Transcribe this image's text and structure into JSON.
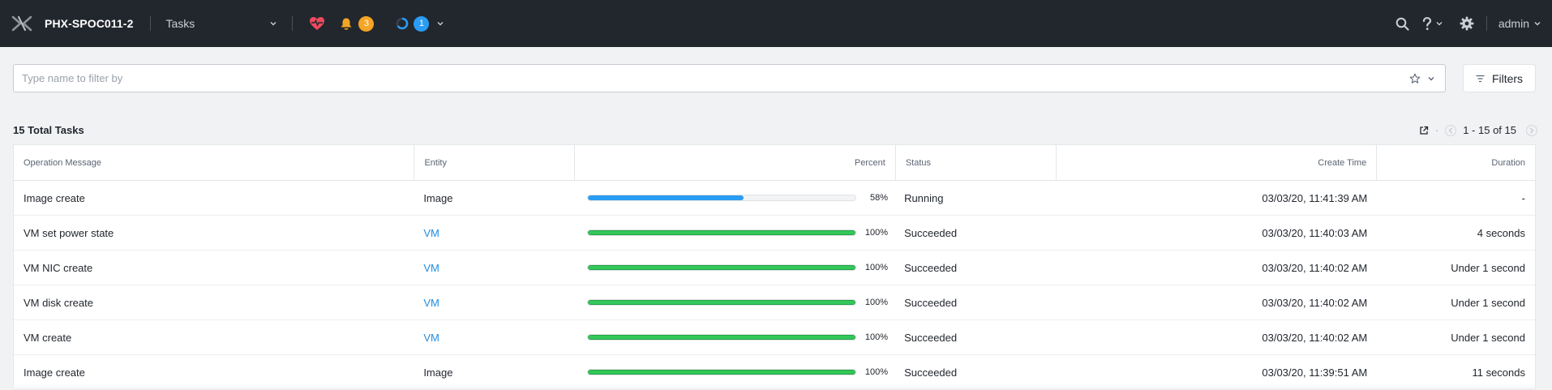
{
  "header": {
    "cluster_name": "PHX-SPOC011-2",
    "nav_selected": "Tasks",
    "alerts_count": "3",
    "tasks_count": "1",
    "user": "admin"
  },
  "filter": {
    "placeholder": "Type name to filter by",
    "filters_label": "Filters"
  },
  "summary": {
    "total_label": "15 Total Tasks",
    "pager_text": "1 - 15 of 15"
  },
  "table": {
    "columns": [
      "Operation Message",
      "Entity",
      "Percent",
      "Status",
      "Create Time",
      "Duration"
    ],
    "rows": [
      {
        "operation": "Image create",
        "entity": "Image",
        "entity_link": false,
        "percent": 58,
        "percent_label": "58%",
        "status": "Running",
        "create_time": "03/03/20, 11:41:39 AM",
        "duration": "-"
      },
      {
        "operation": "VM set power state",
        "entity": "VM",
        "entity_link": true,
        "percent": 100,
        "percent_label": "100%",
        "status": "Succeeded",
        "create_time": "03/03/20, 11:40:03 AM",
        "duration": "4 seconds"
      },
      {
        "operation": "VM NIC create",
        "entity": "VM",
        "entity_link": true,
        "percent": 100,
        "percent_label": "100%",
        "status": "Succeeded",
        "create_time": "03/03/20, 11:40:02 AM",
        "duration": "Under 1 second"
      },
      {
        "operation": "VM disk create",
        "entity": "VM",
        "entity_link": true,
        "percent": 100,
        "percent_label": "100%",
        "status": "Succeeded",
        "create_time": "03/03/20, 11:40:02 AM",
        "duration": "Under 1 second"
      },
      {
        "operation": "VM create",
        "entity": "VM",
        "entity_link": true,
        "percent": 100,
        "percent_label": "100%",
        "status": "Succeeded",
        "create_time": "03/03/20, 11:40:02 AM",
        "duration": "Under 1 second"
      },
      {
        "operation": "Image create",
        "entity": "Image",
        "entity_link": false,
        "percent": 100,
        "percent_label": "100%",
        "status": "Succeeded",
        "create_time": "03/03/20, 11:39:51 AM",
        "duration": "11 seconds"
      }
    ]
  },
  "icons": {
    "logo": "nutanix-x-logo",
    "health": "heart-pulse-icon",
    "alerts": "bell-icon",
    "tasks": "spinner-icon",
    "search": "search-icon",
    "help": "question-icon",
    "settings": "gear-icon",
    "star": "star-icon",
    "filter": "funnel-icon",
    "export": "external-link-icon"
  },
  "colors": {
    "topbar": "#22272e",
    "accent_blue": "#2a9cf3",
    "success_green": "#34c759",
    "alert_orange": "#f5a524",
    "health_red": "#ef4a5d"
  }
}
